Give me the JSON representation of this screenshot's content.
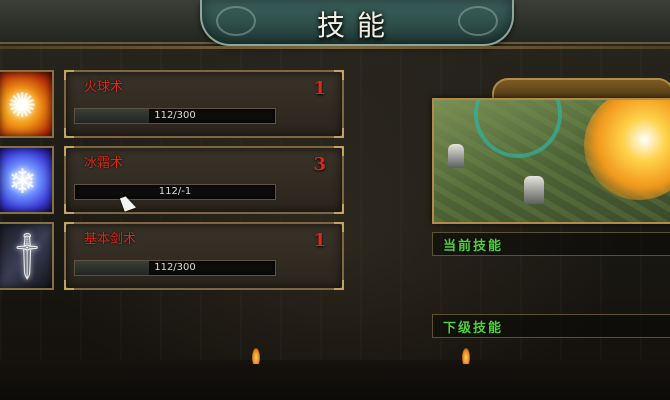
{
  "window": {
    "title": "技能"
  },
  "skills": [
    {
      "name": "火球术",
      "level": "1",
      "xp_text": "112/300",
      "xp_fraction": 0.37,
      "icon": "fireball-icon"
    },
    {
      "name": "冰霜术",
      "level": "3",
      "xp_text": "112/-1",
      "xp_fraction": 0.0,
      "icon": "frost-icon"
    },
    {
      "name": "基本剑术",
      "level": "1",
      "xp_text": "112/300",
      "xp_fraction": 0.37,
      "icon": "sword-icon"
    }
  ],
  "detail": {
    "current_skill_label": "当前技能",
    "next_level_label": "下级技能"
  },
  "colors": {
    "skill_name": "#d42a1e",
    "label_green": "#4fd23a",
    "frame_gold": "#b08b4a"
  }
}
